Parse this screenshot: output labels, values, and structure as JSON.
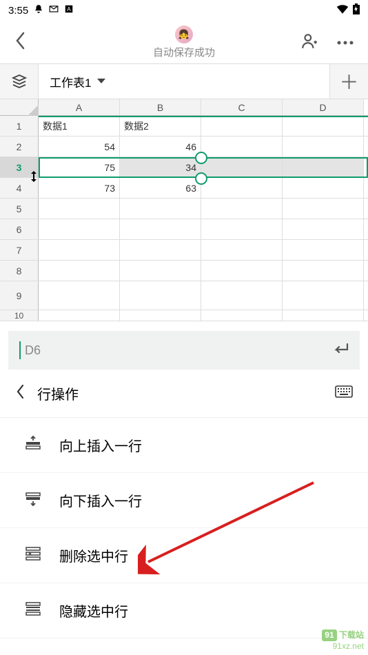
{
  "statusbar": {
    "time": "3:55"
  },
  "header": {
    "subtitle": "自动保存成功"
  },
  "toolbar": {
    "sheet_name": "工作表1"
  },
  "grid": {
    "columns": [
      "A",
      "B",
      "C",
      "D"
    ],
    "rows": [
      {
        "n": "1",
        "cells": [
          "数据1",
          "数据2",
          "",
          ""
        ],
        "kind": "label"
      },
      {
        "n": "2",
        "cells": [
          "54",
          "46",
          "",
          ""
        ]
      },
      {
        "n": "3",
        "cells": [
          "75",
          "34",
          "",
          ""
        ],
        "selected": true
      },
      {
        "n": "4",
        "cells": [
          "73",
          "63",
          "",
          ""
        ]
      },
      {
        "n": "5",
        "cells": [
          "",
          "",
          "",
          ""
        ]
      },
      {
        "n": "6",
        "cells": [
          "",
          "",
          "",
          ""
        ]
      },
      {
        "n": "7",
        "cells": [
          "",
          "",
          "",
          ""
        ]
      },
      {
        "n": "8",
        "cells": [
          "",
          "",
          "",
          ""
        ]
      },
      {
        "n": "9",
        "cells": [
          "",
          "",
          "",
          ""
        ],
        "tall": true
      },
      {
        "n": "10",
        "cells": [
          "",
          "",
          "",
          ""
        ]
      }
    ]
  },
  "formula": {
    "ref": "D6"
  },
  "panel": {
    "title": "行操作",
    "items": [
      {
        "label": "向上插入一行",
        "icon": "insert-above"
      },
      {
        "label": "向下插入一行",
        "icon": "insert-below"
      },
      {
        "label": "删除选中行",
        "icon": "delete-row"
      },
      {
        "label": "隐藏选中行",
        "icon": "hide-row"
      }
    ]
  },
  "watermark": {
    "line1": "91",
    "line2": "下载站",
    "line3": "91xz.net"
  }
}
